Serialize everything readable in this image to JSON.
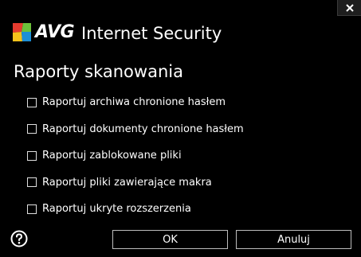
{
  "window": {
    "brand": "AVG",
    "product": "Internet Security",
    "close_icon": "close-icon"
  },
  "dialog": {
    "title": "Raporty skanowania",
    "options": [
      {
        "label": "Raportuj archiwa chronione hasłem",
        "checked": false
      },
      {
        "label": "Raportuj dokumenty chronione hasłem",
        "checked": false
      },
      {
        "label": "Raportuj zablokowane pliki",
        "checked": false
      },
      {
        "label": "Raportuj pliki zawierające makra",
        "checked": false
      },
      {
        "label": "Raportuj ukryte rozszerzenia",
        "checked": false
      }
    ]
  },
  "footer": {
    "help_icon": "help-icon",
    "ok_label": "OK",
    "cancel_label": "Anuluj"
  },
  "colors": {
    "background": "#000000",
    "text": "#ffffff",
    "button_border": "#bdbdbd",
    "logo_red": "#e53b2f",
    "logo_green": "#6cc13a",
    "logo_yellow": "#f5c21b",
    "logo_blue": "#1e8fd6"
  }
}
